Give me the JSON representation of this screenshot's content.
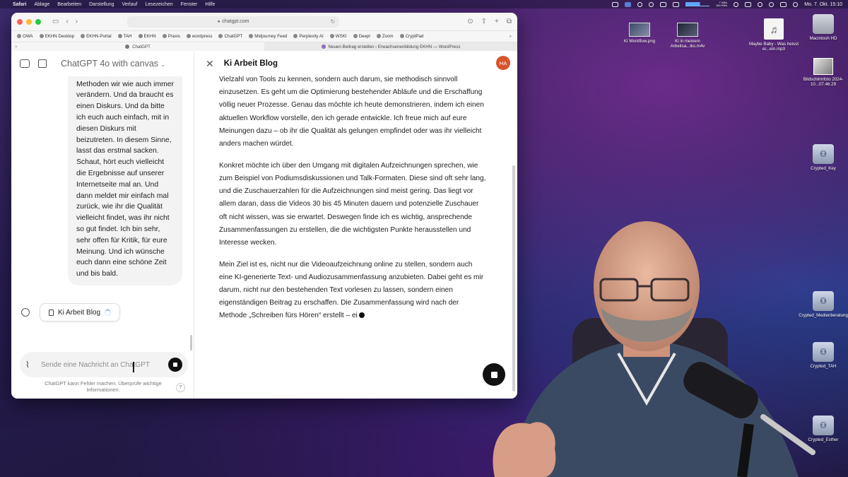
{
  "menubar": {
    "app_name": "Safari",
    "items": [
      "Ablage",
      "Bearbeiten",
      "Darstellung",
      "Verlauf",
      "Lesezeichen",
      "Fenster",
      "Hilfe"
    ],
    "net_up": "7 KB/s",
    "net_down": "184 KB/s",
    "clock": "Mo. 7. Okt.  15:10"
  },
  "desktop_icons": [
    {
      "label": "Ki Workflow.png",
      "kind": "video"
    },
    {
      "label": "Ki in meinem Arbeitsa...lks.m4v",
      "kind": "video-dark"
    },
    {
      "label": "Maybe Baby - Was heisst ei...ein.mp3",
      "kind": "doc"
    },
    {
      "label": "Macintosh HD",
      "kind": "disk"
    },
    {
      "label": "Bildschirmfoto 2024-10...07.46.29",
      "kind": "photo"
    },
    {
      "label": "Crypted_Key",
      "kind": "crypt"
    },
    {
      "label": "Crypted_Medienberatung",
      "kind": "crypt"
    },
    {
      "label": "Crypted_TAH",
      "kind": "crypt"
    },
    {
      "label": "Crypted_Esther",
      "kind": "crypt"
    }
  ],
  "browser": {
    "url": "chatgpt.com",
    "bookmarks": [
      "OWA",
      "EKHN Desktop",
      "EKHN-Portal",
      "TAH",
      "EKHN",
      "Praxis",
      "wordpress",
      "ChatGPT",
      "Midjourney Feed",
      "Perplexity AI",
      "WSKI",
      "Deepl",
      "Zoom",
      "CryptPad"
    ],
    "tabs": [
      {
        "label": "ChatGPT",
        "active": true
      },
      {
        "label": "Neuen Beitrag erstellen ‹ Erwachsenenbildung EKHN — WordPress",
        "active": false
      }
    ]
  },
  "chat": {
    "model_label": "ChatGPT 4o with canvas",
    "user_message_lines": "experimentieren, welche Methoden wir wie auch immer verändern. Und da braucht es einen Diskurs. Und da bitte ich euch auch einfach, mit in diesen Diskurs mit beizutreten. In diesem Sinne, lasst das erstmal sacken. Schaut, hört euch vielleicht die Ergebnisse auf unserer Internetseite mal an. Und dann meldet mir einfach mal zurück, wie ihr die Qualität vielleicht findet, was ihr nicht so gut findet. Ich bin sehr, sehr offen für Kritik, für eure Meinung. Und ich wünsche euch dann eine schöne Zeit und bis bald.",
    "canvas_chip_label": "Ki Arbeit Blog",
    "composer_placeholder": "Sende eine Nachricht an ChatGPT",
    "disclaimer": "ChatGPT kann Fehler machen. Überprüfe wichtige Informationen.",
    "help_label": "?"
  },
  "canvas": {
    "title": "Ki Arbeit Blog",
    "avatar_initials": "HA",
    "paragraphs": [
      "Vielzahl von Tools zu kennen, sondern auch darum, sie methodisch sinnvoll einzusetzen. Es geht um die Optimierung bestehender Abläufe und die Erschaffung völlig neuer Prozesse. Genau das möchte ich heute demonstrieren, indem ich einen aktuellen Workflow vorstelle, den ich gerade entwickle. Ich freue mich auf eure Meinungen dazu – ob ihr die Qualität als gelungen empfindet oder was ihr vielleicht anders machen würdet.",
      "Konkret möchte ich über den Umgang mit digitalen Aufzeichnungen sprechen, wie zum Beispiel von Podiumsdiskussionen und Talk-Formaten. Diese sind oft sehr lang, und die Zuschauerzahlen für die Aufzeichnungen sind meist gering. Das liegt vor allem daran, dass die Videos 30 bis 45 Minuten dauern und potenzielle Zuschauer oft nicht wissen, was sie erwartet. Deswegen finde ich es wichtig, ansprechende Zusammenfassungen zu erstellen, die die wichtigsten Punkte herausstellen und Interesse wecken.",
      "Mein Ziel ist es, nicht nur die Videoaufzeichnung online zu stellen, sondern auch eine KI-generierte Text- und Audiozusammenfassung anzubieten. Dabei geht es mir darum, nicht nur den bestehenden Text vorlesen zu lassen, sondern einen eigenständigen Beitrag zu erschaffen. Die Zusammenfassung wird nach der Methode „Schreiben fürs Hören“ erstellt – ei"
    ]
  }
}
